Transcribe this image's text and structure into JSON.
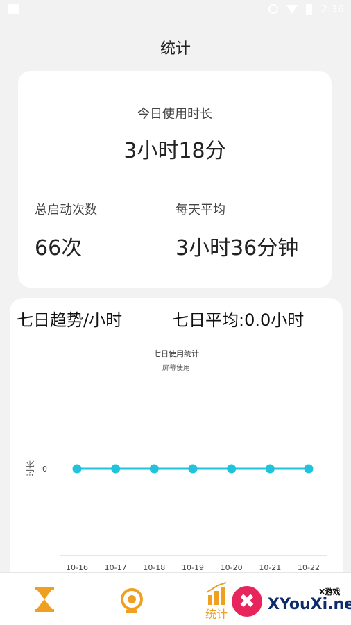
{
  "status_bar": {
    "time": "2:36"
  },
  "page_title": "统计",
  "summary": {
    "today_label": "今日使用时长",
    "today_value": "3小时18分",
    "launch_label": "总启动次数",
    "launch_value": "66次",
    "daily_avg_label": "每天平均",
    "daily_avg_value": "3小时36分钟"
  },
  "trend": {
    "title": "七日趋势/小时",
    "avg_text": "七日平均:0.0小时"
  },
  "chart_data": {
    "type": "line",
    "title": "七日使用统计",
    "legend": "屏幕使用",
    "ylabel": "时长",
    "yticks": [
      "0"
    ],
    "x": [
      "10-16",
      "10-17",
      "10-18",
      "10-19",
      "10-20",
      "10-21",
      "10-22"
    ],
    "series": [
      {
        "name": "屏幕使用",
        "values": [
          0,
          0,
          0,
          0,
          0,
          0,
          0
        ]
      }
    ],
    "ylim": [
      0,
      0
    ],
    "grid": false,
    "line_color": "#1fc3dc"
  },
  "bottom_nav": {
    "items": [
      {
        "icon": "hourglass-icon"
      },
      {
        "icon": "record-icon"
      },
      {
        "icon": "stats-icon",
        "label": "统计"
      }
    ],
    "accent": "#f0a020"
  },
  "watermark": {
    "small": "X游戏",
    "text": "XYouXi.net"
  }
}
